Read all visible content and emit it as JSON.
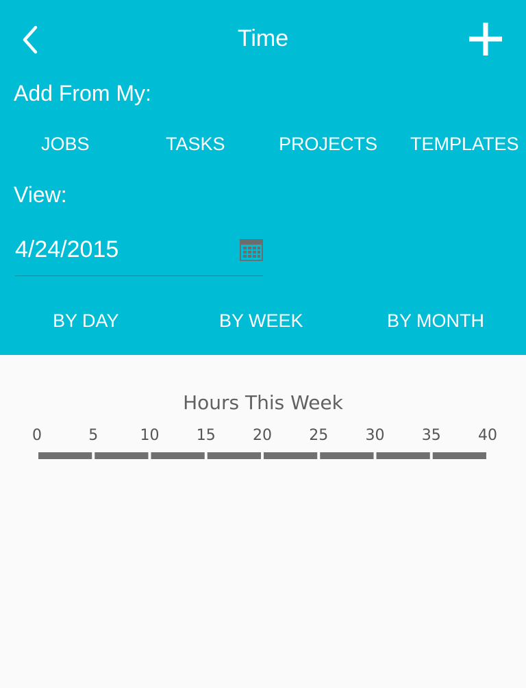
{
  "header": {
    "title": "Time",
    "back_icon": "chevron-left-icon",
    "add_icon": "plus-icon",
    "background_color": "#00bcd4",
    "text_color": "#ffffff"
  },
  "add_from": {
    "label": "Add From My:",
    "tabs": [
      "JOBS",
      "TASKS",
      "PROJECTS",
      "TEMPLATES"
    ]
  },
  "view": {
    "label": "View:",
    "date_value": "4/24/2015",
    "calendar_icon": "calendar-icon",
    "tabs": [
      "BY DAY",
      "BY WEEK",
      "BY MONTH"
    ]
  },
  "hours_chart": {
    "title": "Hours This Week",
    "ticks": [
      "0",
      "5",
      "10",
      "15",
      "20",
      "25",
      "30",
      "35",
      "40"
    ],
    "segment_color": "#707070"
  },
  "chart_data": {
    "type": "bar",
    "title": "Hours This Week",
    "xlabel": "",
    "ylabel": "",
    "xlim": [
      0,
      40
    ],
    "x_ticks": [
      0,
      5,
      10,
      15,
      20,
      25,
      30,
      35,
      40
    ],
    "categories": [],
    "values": [],
    "grid": false
  }
}
